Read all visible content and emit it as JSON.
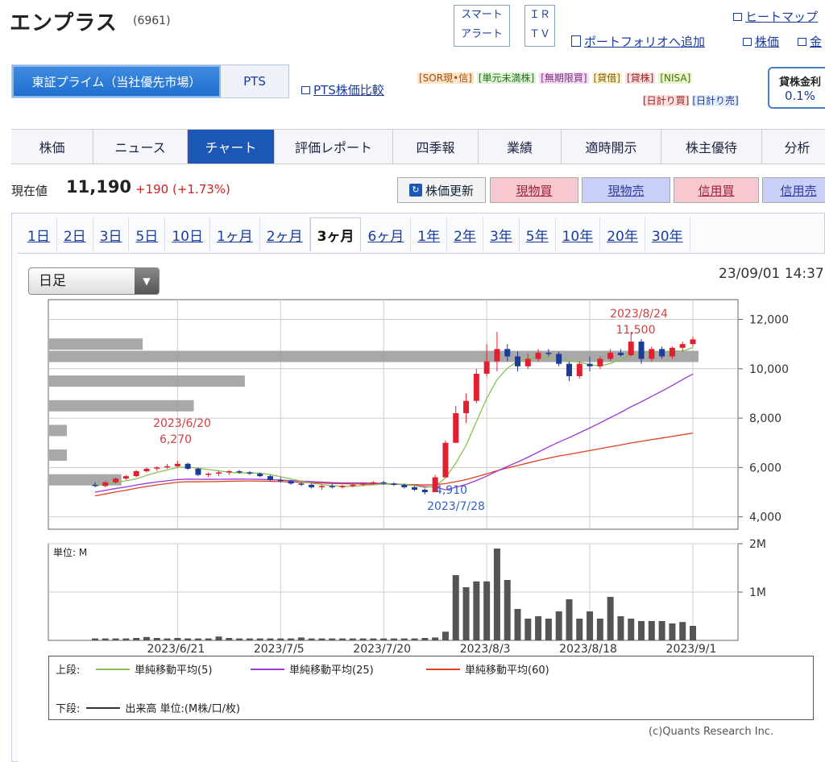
{
  "header": {
    "title": "エンプラス",
    "code": "(6961)",
    "smart_alert": [
      "スマート",
      "アラート"
    ],
    "ir_tv": [
      "ＩＲ",
      "ＴＶ"
    ],
    "heatmap": "ヒートマップ",
    "portfolio": "ポートフォリオへ追加",
    "kabuka": "株価",
    "kin": "金"
  },
  "market_tabs": [
    "東証プライム（当社優先市場）",
    "PTS"
  ],
  "pts_compare": "PTS株価比較",
  "tags": {
    "row1": [
      "[SOR現•信]",
      "[単元未満株]",
      "[無期限買]",
      "[貸借]",
      "[貸株]",
      "[NISA]"
    ],
    "row2": [
      "[日計り買]",
      "[日計り売]"
    ]
  },
  "lending": {
    "label": "貸株金利",
    "value": "0.1%"
  },
  "nav_tabs": [
    "株価",
    "ニュース",
    "チャート",
    "評価レポート",
    "四季報",
    "業績",
    "適時開示",
    "株主優待",
    "分析"
  ],
  "quote": {
    "label": "現在値",
    "price": "11,190",
    "change": "+190 (+1.73%)"
  },
  "buttons": {
    "refresh": "株価更新",
    "buy": "現物買",
    "sell": "現物売",
    "margin_buy": "信用買",
    "margin_sell": "信用売"
  },
  "periods": [
    "1日",
    "2日",
    "3日",
    "5日",
    "10日",
    "1ヶ月",
    "2ヶ月",
    "3ヶ月",
    "6ヶ月",
    "1年",
    "2年",
    "3年",
    "5年",
    "10年",
    "20年",
    "30年"
  ],
  "active_period": "3ヶ月",
  "interval_select": "日足",
  "datetime": "23/09/01 14:37",
  "chart_data": {
    "type": "candlestick",
    "price_axis": {
      "ticks": [
        "12,000",
        "10,000",
        "8,000",
        "6,000",
        "4,000"
      ],
      "range": [
        3500,
        12800
      ]
    },
    "volume_axis": {
      "ticks": [
        "2M",
        "1M"
      ],
      "unit_label": "単位: M",
      "range": [
        0,
        2.0
      ]
    },
    "x_ticks": [
      "2023/6/21",
      "2023/7/5",
      "2023/7/20",
      "2023/8/3",
      "2023/8/18",
      "2023/9/1"
    ],
    "annotations": {
      "high": {
        "date": "2023/8/24",
        "value": "11,500"
      },
      "mid_high": {
        "date": "2023/6/20",
        "value": "6,270"
      },
      "low": {
        "date": "2023/7/28",
        "value": "4,910"
      }
    },
    "candles": [
      {
        "o": 5300,
        "h": 5400,
        "l": 5200,
        "c": 5250
      },
      {
        "o": 5250,
        "h": 5450,
        "l": 5200,
        "c": 5400
      },
      {
        "o": 5400,
        "h": 5600,
        "l": 5350,
        "c": 5550
      },
      {
        "o": 5550,
        "h": 5700,
        "l": 5500,
        "c": 5650
      },
      {
        "o": 5650,
        "h": 5900,
        "l": 5600,
        "c": 5850
      },
      {
        "o": 5850,
        "h": 6000,
        "l": 5800,
        "c": 5950
      },
      {
        "o": 5950,
        "h": 6050,
        "l": 5850,
        "c": 6000
      },
      {
        "o": 6000,
        "h": 6150,
        "l": 5950,
        "c": 6050
      },
      {
        "o": 6050,
        "h": 6270,
        "l": 6000,
        "c": 6150
      },
      {
        "o": 6150,
        "h": 6200,
        "l": 5900,
        "c": 5950
      },
      {
        "o": 5950,
        "h": 6000,
        "l": 5650,
        "c": 5700
      },
      {
        "o": 5700,
        "h": 5800,
        "l": 5600,
        "c": 5750
      },
      {
        "o": 5750,
        "h": 5850,
        "l": 5650,
        "c": 5800
      },
      {
        "o": 5800,
        "h": 5900,
        "l": 5700,
        "c": 5850
      },
      {
        "o": 5850,
        "h": 5900,
        "l": 5750,
        "c": 5800
      },
      {
        "o": 5800,
        "h": 5850,
        "l": 5700,
        "c": 5750
      },
      {
        "o": 5750,
        "h": 5800,
        "l": 5600,
        "c": 5650
      },
      {
        "o": 5650,
        "h": 5700,
        "l": 5450,
        "c": 5500
      },
      {
        "o": 5500,
        "h": 5600,
        "l": 5400,
        "c": 5450
      },
      {
        "o": 5450,
        "h": 5500,
        "l": 5300,
        "c": 5350
      },
      {
        "o": 5350,
        "h": 5400,
        "l": 5250,
        "c": 5300
      },
      {
        "o": 5300,
        "h": 5350,
        "l": 5150,
        "c": 5200
      },
      {
        "o": 5200,
        "h": 5300,
        "l": 5100,
        "c": 5250
      },
      {
        "o": 5250,
        "h": 5350,
        "l": 5150,
        "c": 5200
      },
      {
        "o": 5200,
        "h": 5300,
        "l": 5150,
        "c": 5250
      },
      {
        "o": 5250,
        "h": 5350,
        "l": 5200,
        "c": 5300
      },
      {
        "o": 5300,
        "h": 5400,
        "l": 5250,
        "c": 5350
      },
      {
        "o": 5350,
        "h": 5450,
        "l": 5300,
        "c": 5400
      },
      {
        "o": 5400,
        "h": 5450,
        "l": 5300,
        "c": 5350
      },
      {
        "o": 5350,
        "h": 5400,
        "l": 5250,
        "c": 5300
      },
      {
        "o": 5300,
        "h": 5350,
        "l": 5150,
        "c": 5200
      },
      {
        "o": 5200,
        "h": 5250,
        "l": 5050,
        "c": 5100
      },
      {
        "o": 5100,
        "h": 5150,
        "l": 4910,
        "c": 5000
      },
      {
        "o": 5000,
        "h": 5700,
        "l": 5000,
        "c": 5600
      },
      {
        "o": 5600,
        "h": 7100,
        "l": 5600,
        "c": 7000
      },
      {
        "o": 7000,
        "h": 8500,
        "l": 7000,
        "c": 8200
      },
      {
        "o": 8200,
        "h": 9000,
        "l": 7800,
        "c": 8700
      },
      {
        "o": 8700,
        "h": 10000,
        "l": 8600,
        "c": 9800
      },
      {
        "o": 9800,
        "h": 11000,
        "l": 9700,
        "c": 10300
      },
      {
        "o": 10300,
        "h": 11500,
        "l": 9900,
        "c": 10800
      },
      {
        "o": 10800,
        "h": 11000,
        "l": 10300,
        "c": 10500
      },
      {
        "o": 10500,
        "h": 10700,
        "l": 9900,
        "c": 10100
      },
      {
        "o": 10100,
        "h": 10600,
        "l": 10000,
        "c": 10400
      },
      {
        "o": 10400,
        "h": 10800,
        "l": 10300,
        "c": 10650
      },
      {
        "o": 10650,
        "h": 10800,
        "l": 10500,
        "c": 10600
      },
      {
        "o": 10600,
        "h": 10700,
        "l": 10100,
        "c": 10200
      },
      {
        "o": 10200,
        "h": 10300,
        "l": 9500,
        "c": 9700
      },
      {
        "o": 9700,
        "h": 10300,
        "l": 9600,
        "c": 10200
      },
      {
        "o": 10200,
        "h": 10500,
        "l": 9900,
        "c": 10100
      },
      {
        "o": 10100,
        "h": 10500,
        "l": 10000,
        "c": 10400
      },
      {
        "o": 10400,
        "h": 10800,
        "l": 10300,
        "c": 10650
      },
      {
        "o": 10650,
        "h": 10800,
        "l": 10500,
        "c": 10550
      },
      {
        "o": 10550,
        "h": 11500,
        "l": 10500,
        "c": 11100
      },
      {
        "o": 11100,
        "h": 11200,
        "l": 10200,
        "c": 10400
      },
      {
        "o": 10400,
        "h": 10900,
        "l": 10300,
        "c": 10800
      },
      {
        "o": 10800,
        "h": 10900,
        "l": 10400,
        "c": 10500
      },
      {
        "o": 10500,
        "h": 10900,
        "l": 10400,
        "c": 10850
      },
      {
        "o": 10850,
        "h": 11100,
        "l": 10700,
        "c": 11000
      },
      {
        "o": 11000,
        "h": 11300,
        "l": 10900,
        "c": 11190
      }
    ],
    "volume": [
      0.04,
      0.04,
      0.04,
      0.04,
      0.05,
      0.07,
      0.05,
      0.04,
      0.05,
      0.04,
      0.04,
      0.04,
      0.08,
      0.05,
      0.04,
      0.04,
      0.04,
      0.04,
      0.04,
      0.04,
      0.06,
      0.04,
      0.04,
      0.04,
      0.04,
      0.04,
      0.04,
      0.04,
      0.04,
      0.04,
      0.04,
      0.04,
      0.05,
      0.06,
      0.18,
      1.35,
      1.1,
      1.22,
      1.22,
      1.9,
      1.25,
      0.65,
      0.45,
      0.5,
      0.45,
      0.6,
      0.85,
      0.45,
      0.6,
      0.45,
      0.9,
      0.5,
      0.45,
      0.4,
      0.4,
      0.4,
      0.35,
      0.38,
      0.3
    ],
    "ma5_color": "#8ac050",
    "ma25_color": "#9a38d8",
    "ma60_color": "#e04020",
    "volume_profile": [
      {
        "price": 11000,
        "len": 0.22
      },
      {
        "price": 10500,
        "len": 1.0
      },
      {
        "price": 9500,
        "len": 0.46
      },
      {
        "price": 8500,
        "len": 0.34
      },
      {
        "price": 7500,
        "len": 0.03
      },
      {
        "price": 6500,
        "len": 0.03
      },
      {
        "price": 5500,
        "len": 0.17
      }
    ]
  },
  "legend": {
    "upper_label": "上段:",
    "lower_label": "下段:",
    "ma5": "単純移動平均(5)",
    "ma25": "単純移動平均(25)",
    "ma60": "単純移動平均(60)",
    "volume": "出来高 単位:(M株/口/枚)"
  },
  "credit": "(c)Quants Research Inc."
}
